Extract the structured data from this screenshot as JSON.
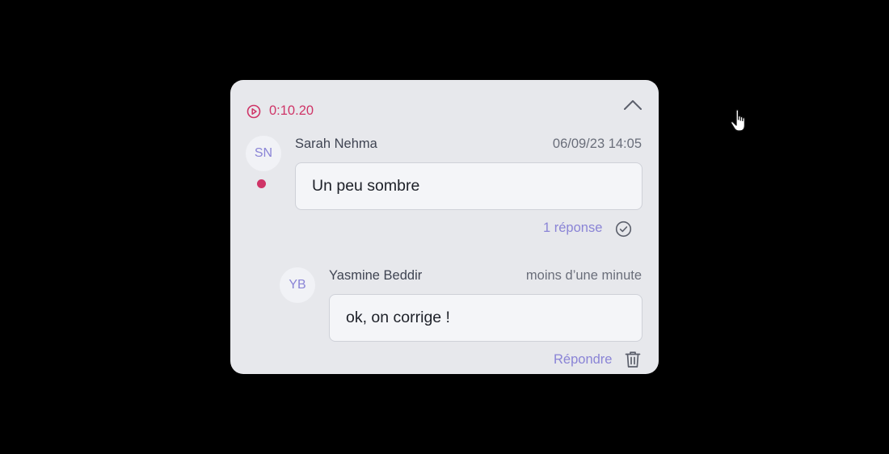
{
  "comment": {
    "timecode": "0:10.20",
    "author_initials": "SN",
    "author_name": "Sarah Nehma",
    "timestamp": "06/09/23 14:05",
    "text": "Un peu sombre",
    "replies_label": "1 réponse"
  },
  "reply": {
    "author_initials": "YB",
    "author_name": "Yasmine Beddir",
    "timestamp": "moins d’une minute",
    "text": "ok, on corrige !",
    "reply_label": "Répondre"
  },
  "colors": {
    "accent_timecode": "#cf3467",
    "accent_link": "#8a84d6",
    "card_background": "#e7e8ec",
    "page_background": "#000000"
  },
  "icons": {
    "timecode": "play-circle-icon",
    "collapse": "chevron-up-icon",
    "resolve": "check-circle-icon",
    "delete": "trash-icon",
    "pointer": "hand-pointer-icon"
  }
}
